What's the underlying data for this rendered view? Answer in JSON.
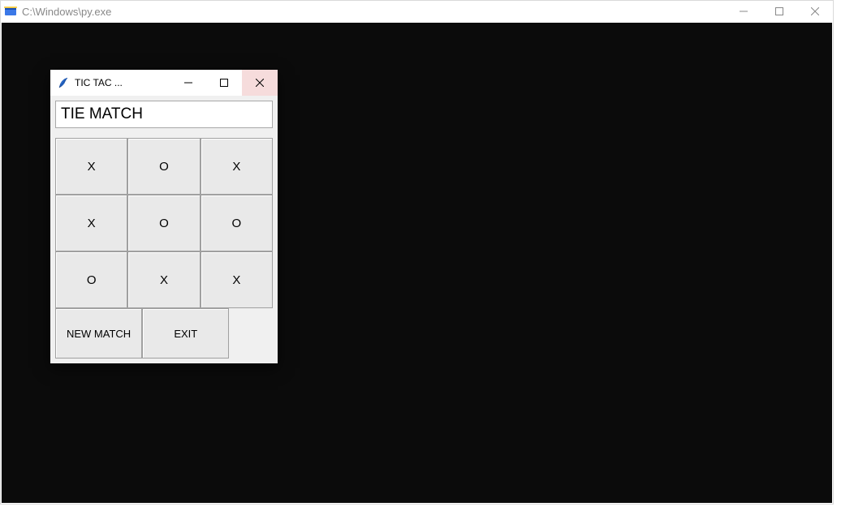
{
  "console": {
    "title": "C:\\Windows\\py.exe"
  },
  "app": {
    "title": "TIC TAC ...",
    "status": "TIE MATCH",
    "board": [
      "X",
      "O",
      "X",
      "X",
      "O",
      "O",
      "O",
      "X",
      "X"
    ],
    "new_match_label": "NEW MATCH",
    "exit_label": "EXIT"
  }
}
